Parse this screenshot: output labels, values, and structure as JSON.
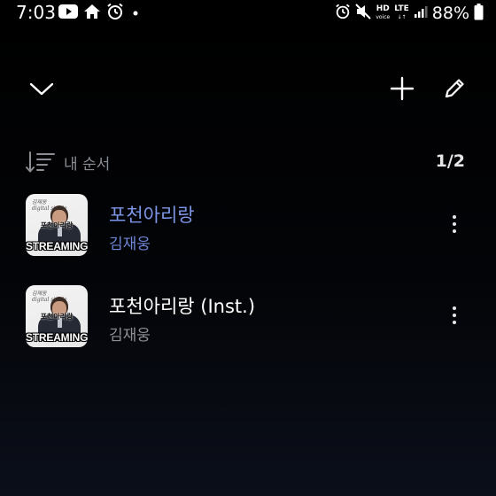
{
  "status_bar": {
    "time": "7:03",
    "hd_label": "HD",
    "hd_sub": "voice",
    "lte_label": "LTE",
    "battery_percent": "88%"
  },
  "toolbar": {
    "collapse_icon": "chevron-down-icon",
    "add_icon": "plus-icon",
    "edit_icon": "pencil-icon"
  },
  "sort": {
    "label": "내 순서",
    "icon": "sort-icon"
  },
  "page_counter": "1/2",
  "tracks": [
    {
      "title": "포천아리랑",
      "artist": "김재웅",
      "active": true,
      "thumbnail": {
        "top_text": "김재웅\ndigital single",
        "center_text": "포천아리랑",
        "badge": "STREAMING"
      }
    },
    {
      "title": "포천아리랑 (Inst.)",
      "artist": "김재웅",
      "active": false,
      "thumbnail": {
        "top_text": "김재웅\ndigital single",
        "center_text": "포천아리랑",
        "badge": "STREAMING"
      }
    }
  ],
  "colors": {
    "background": "#000000",
    "active_accent": "#7d95e6",
    "secondary_text": "#8f9198"
  }
}
